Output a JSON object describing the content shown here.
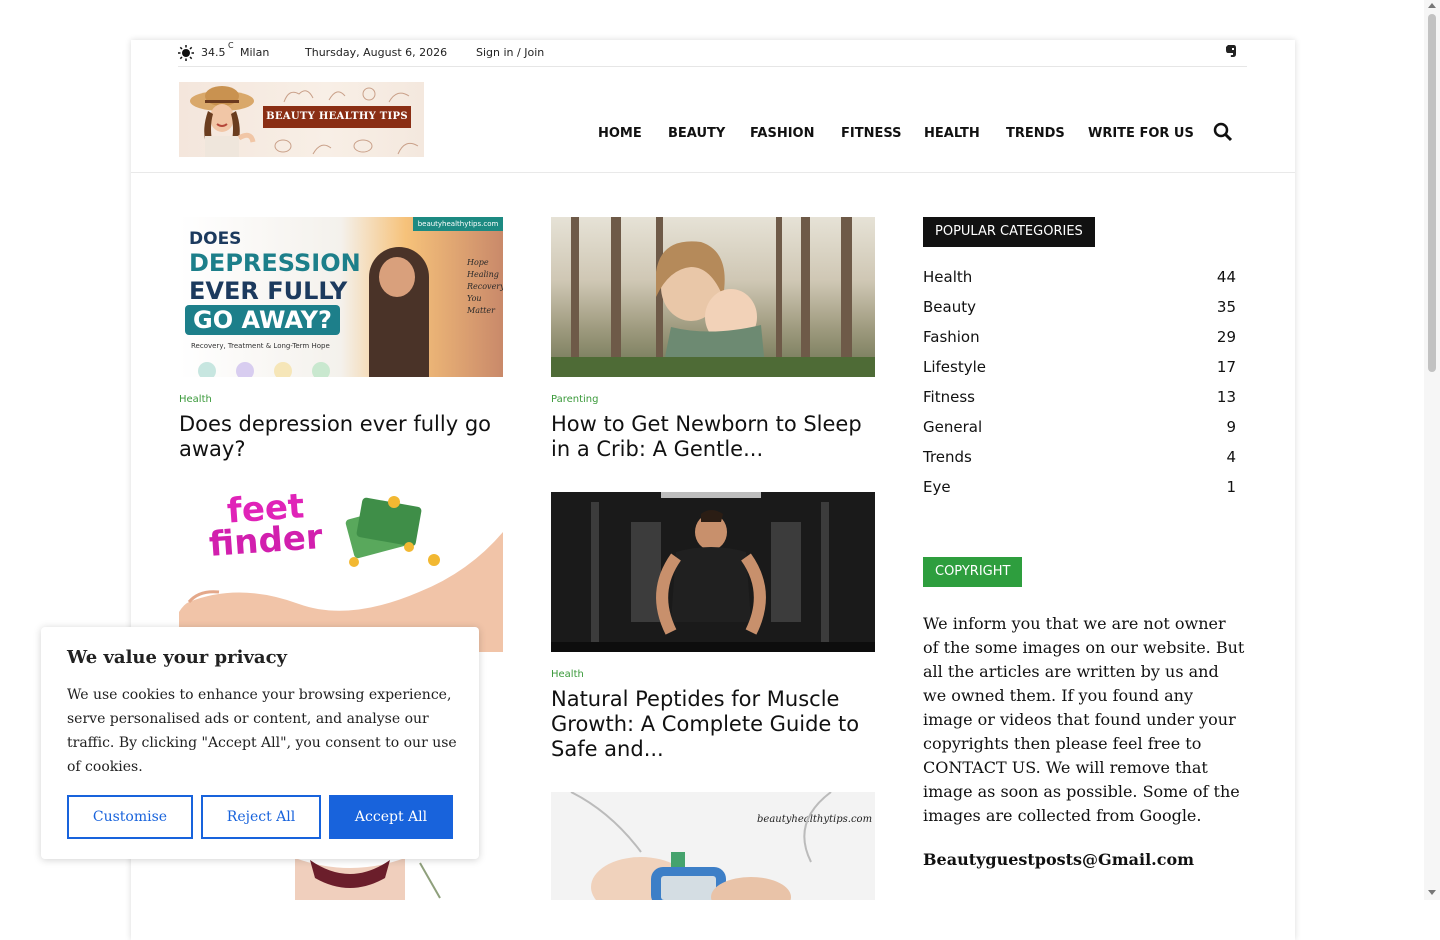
{
  "topbar": {
    "temp": "34.5",
    "unit": "C",
    "city": "Milan",
    "date": "Thursday, August 6, 2026",
    "signin": "Sign in / Join",
    "social_icon": "evernote-icon"
  },
  "logo": {
    "text": "BEAUTY HEALTHY TIPS"
  },
  "nav": {
    "items": [
      {
        "label": "HOME"
      },
      {
        "label": "BEAUTY"
      },
      {
        "label": "FASHION"
      },
      {
        "label": "FITNESS"
      },
      {
        "label": "HEALTH"
      },
      {
        "label": "TRENDS"
      },
      {
        "label": "WRITE FOR US"
      }
    ],
    "search_icon": "search-icon"
  },
  "posts": [
    {
      "category": "Health",
      "title": "Does depression ever fully go away?",
      "image_text": {
        "site": "beautyhealthytips.com",
        "line1": "DOES",
        "line2": "DEPRESSION",
        "line3": "EVER FULLY",
        "line4": "GO AWAY?",
        "sub": "Recovery, Treatment & Long-Term Hope",
        "script1": "Hope",
        "script2": "Healing",
        "script3": "Recovery",
        "script4": "You Matter"
      }
    },
    {
      "category": "Parenting",
      "title": "How to Get Newborn to Sleep in a Crib: A Gentle..."
    },
    {
      "category": "",
      "title": "",
      "image_text": {
        "line1": "feet",
        "line2": "finder"
      }
    },
    {
      "category": "Health",
      "title": "Natural Peptides for Muscle Growth: A Complete Guide to Safe and..."
    },
    {
      "image_text": {
        "site": "beautyhealthytips.com"
      }
    }
  ],
  "sidebar": {
    "popular_heading": "POPULAR CATEGORIES",
    "categories": [
      {
        "name": "Health",
        "count": "44"
      },
      {
        "name": "Beauty",
        "count": "35"
      },
      {
        "name": "Fashion",
        "count": "29"
      },
      {
        "name": "Lifestyle",
        "count": "17"
      },
      {
        "name": "Fitness",
        "count": "13"
      },
      {
        "name": "General",
        "count": "9"
      },
      {
        "name": "Trends",
        "count": "4"
      },
      {
        "name": "Eye",
        "count": "1"
      }
    ],
    "copyright_heading": "COPYRIGHT",
    "copyright_text": "We inform you that we are not owner of the some images on our website. But all the articles are written by us and we owned them. If you found any image or videos that found under your copyrights then please feel free to CONTACT US. We will remove that image as soon as possible. Some of the images are collected from Google.",
    "email": "Beautyguestposts@Gmail.com"
  },
  "cookie": {
    "title": "We value your privacy",
    "text": "We use cookies to enhance your browsing experience, serve personalised ads or content, and analyse our traffic. By clicking \"Accept All\", you consent to our use of cookies.",
    "customise": "Customise",
    "reject": "Reject All",
    "accept": "Accept All"
  },
  "colors": {
    "accent_green": "#3b9a3b",
    "copyright_green": "#2e9e3e",
    "heading_black": "#111111",
    "cookie_blue": "#1863dc",
    "logo_banner": "#8a2e14"
  }
}
